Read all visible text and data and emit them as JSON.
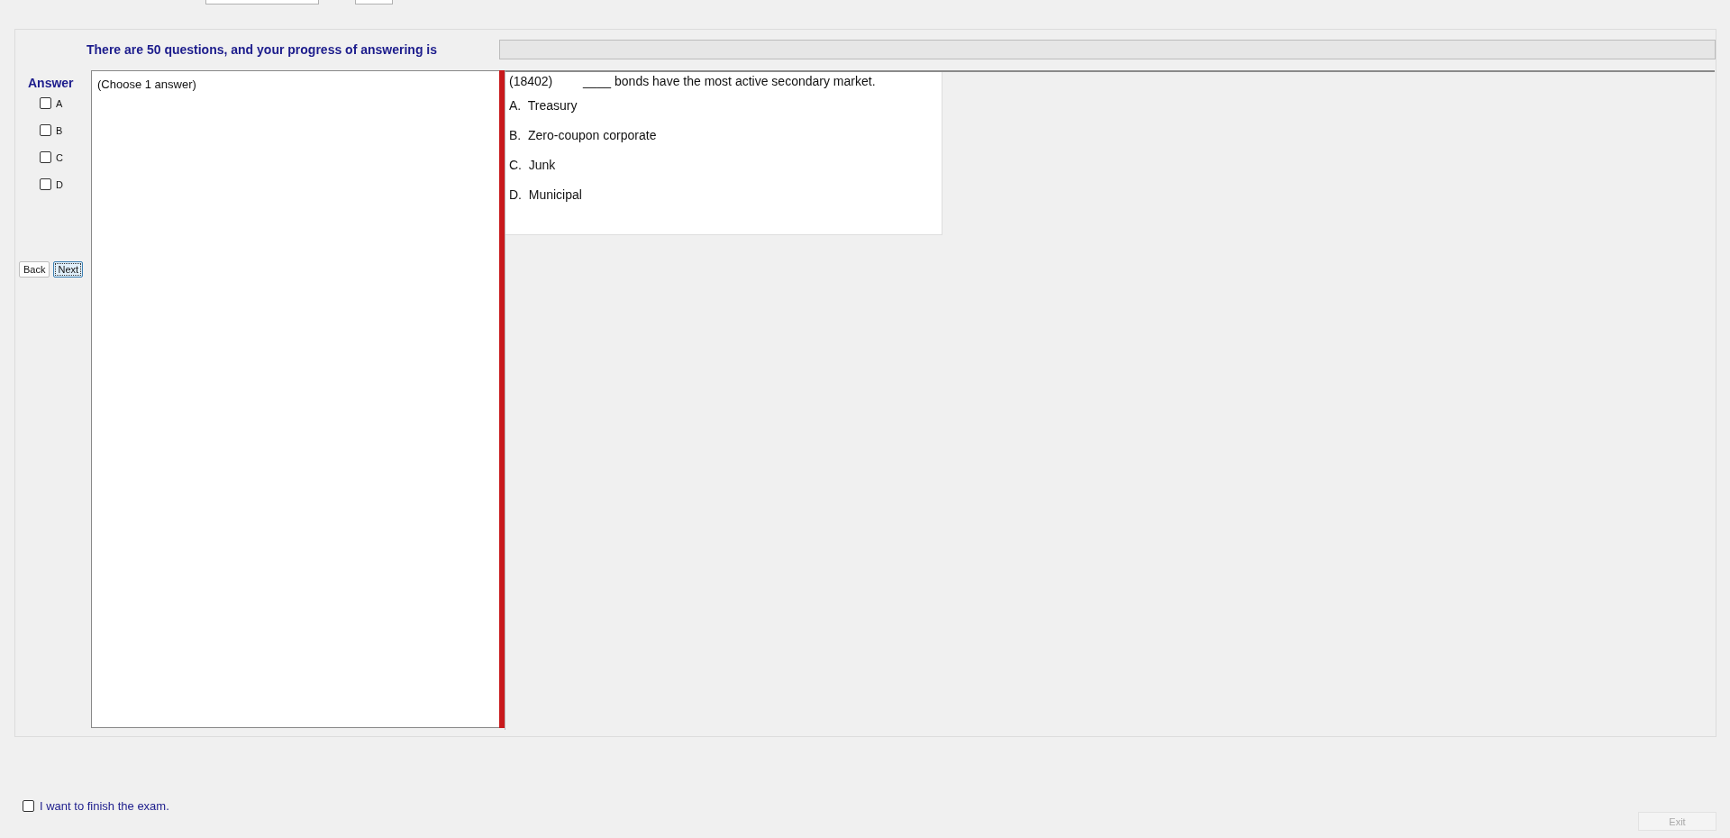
{
  "progress": {
    "label": "There are 50 questions, and your progress of answering is",
    "level": 0
  },
  "answer_panel": {
    "title": "Answer",
    "options": [
      {
        "label": "A",
        "checked": false
      },
      {
        "label": "B",
        "checked": false
      },
      {
        "label": "C",
        "checked": false
      },
      {
        "label": "D",
        "checked": false
      }
    ]
  },
  "nav_buttons": [
    {
      "label": "Back",
      "focused": false
    },
    {
      "label": "Next",
      "focused": true
    }
  ],
  "answer_box": {
    "text": "(Choose 1 answer)"
  },
  "question": {
    "number": "(18402)",
    "text": "____ bonds have the most active secondary market.",
    "choices": [
      {
        "letter": "A.",
        "text": "Treasury"
      },
      {
        "letter": "B.",
        "text": "Zero-coupon corporate"
      },
      {
        "letter": "C.",
        "text": "Junk"
      },
      {
        "letter": "D.",
        "text": "Municipal"
      }
    ]
  },
  "finish": {
    "label": "I want to finish the exam.",
    "checked": false
  },
  "exit_button": {
    "label": "Exit",
    "disabled": true
  }
}
